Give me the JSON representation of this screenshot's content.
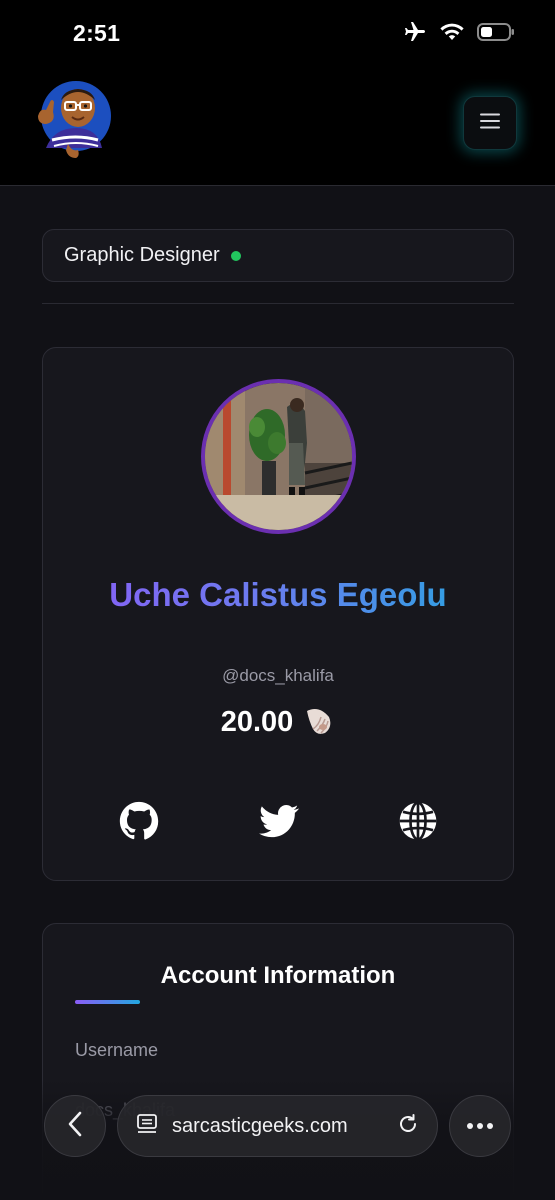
{
  "status_bar": {
    "time": "2:51",
    "icons": [
      "airplane-icon",
      "wifi-icon",
      "battery-icon"
    ]
  },
  "header": {
    "logo_icon": "cartoon-avatar-icon",
    "menu_icon": "hamburger-menu-icon"
  },
  "role": {
    "label": "Graphic Designer",
    "status_color": "#22c55e"
  },
  "profile": {
    "name": "Uche Calistus Egeolu",
    "handle": "@docs_khalifa",
    "balance": "20.00",
    "balance_icon": "seashell-icon",
    "socials": [
      {
        "icon": "github-icon"
      },
      {
        "icon": "twitter-icon"
      },
      {
        "icon": "globe-icon"
      }
    ]
  },
  "account": {
    "title": "Account Information",
    "fields": [
      {
        "label": "Username",
        "value": "docs_khalifa"
      }
    ]
  },
  "browser": {
    "url": "sarcasticgeeks.com",
    "back_icon": "chevron-left-icon",
    "reader_icon": "reader-icon",
    "reload_icon": "reload-icon",
    "more_icon": "more-icon"
  },
  "colors": {
    "accent_purple": "#8b5cf6",
    "accent_blue": "#22a8e0",
    "menu_glow": "#1496a0",
    "photo_ring": "#6b2fb0"
  }
}
